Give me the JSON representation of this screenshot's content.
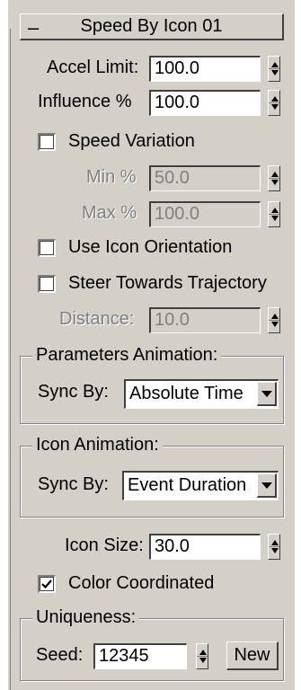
{
  "rollout": {
    "collapse_glyph": "–",
    "title": "Speed By Icon 01"
  },
  "accel_limit": {
    "label": "Accel Limit:",
    "value": "100.0"
  },
  "influence": {
    "label": "Influence %",
    "value": "100.0"
  },
  "speed_variation": {
    "label": "Speed Variation",
    "checked": false
  },
  "min_pct": {
    "label": "Min %",
    "value": "50.0"
  },
  "max_pct": {
    "label": "Max %",
    "value": "100.0"
  },
  "use_icon_orientation": {
    "label": "Use Icon Orientation",
    "checked": false
  },
  "steer_towards_trajectory": {
    "label": "Steer Towards Trajectory",
    "checked": false
  },
  "distance": {
    "label": "Distance:",
    "value": "10.0"
  },
  "parameters_animation": {
    "title": "Parameters Animation:",
    "sync_label": "Sync By:",
    "sync_value": "Absolute Time"
  },
  "icon_animation": {
    "title": "Icon Animation:",
    "sync_label": "Sync By:",
    "sync_value": "Event Duration"
  },
  "icon_size": {
    "label": "Icon Size:",
    "value": "30.0"
  },
  "color_coordinated": {
    "label": "Color Coordinated",
    "checked": true
  },
  "uniqueness": {
    "title": "Uniqueness:",
    "seed_label": "Seed:",
    "seed_value": "12345",
    "new_button": "New"
  }
}
